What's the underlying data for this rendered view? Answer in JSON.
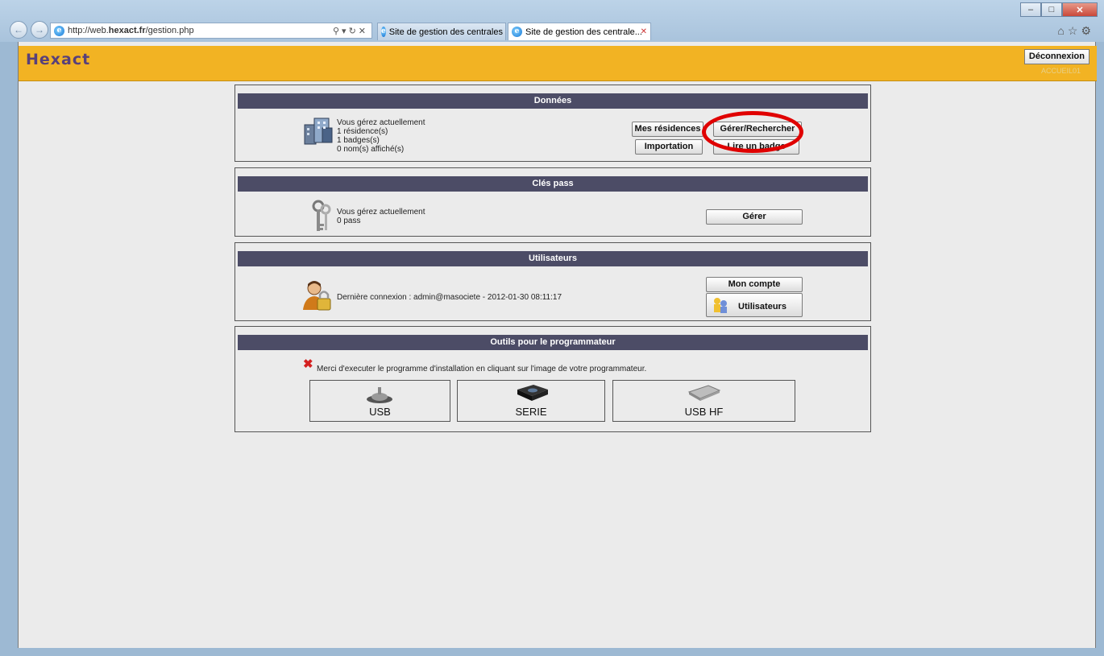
{
  "browser": {
    "url_prefix": "http://web.",
    "url_domain": "hexact.fr",
    "url_path": "/gestion.php",
    "tabs": [
      {
        "label": "Site de gestion des centrales H..."
      },
      {
        "label": "Site de gestion des centrale..."
      }
    ]
  },
  "header": {
    "logo": "Hexact",
    "logout_label": "Déconnexion",
    "user_code": "ACCUEIL01"
  },
  "sections": {
    "donnees": {
      "title": "Données",
      "info": [
        "Vous gérez actuellement",
        "1 résidence(s)",
        "1 badges(s)",
        "0 nom(s) affiché(s)"
      ],
      "buttons": {
        "mes_residences": "Mes résidences",
        "gerer_rechercher": "Gérer/Rechercher",
        "importation": "Importation",
        "lire_badge": "Lire un badge"
      }
    },
    "cles_pass": {
      "title": "Clés pass",
      "info": [
        "Vous gérez actuellement",
        "0 pass"
      ],
      "buttons": {
        "gerer": "Gérer"
      }
    },
    "utilisateurs": {
      "title": "Utilisateurs",
      "info": "Dernière connexion : admin@masociete - 2012-01-30 08:11:17",
      "buttons": {
        "mon_compte": "Mon compte",
        "utilisateurs": "Utilisateurs"
      }
    },
    "outils": {
      "title": "Outils pour le programmateur",
      "message": "Merci d'executer le programme d'installation en cliquant sur l'image de votre programmateur.",
      "programmers": [
        {
          "label": "USB"
        },
        {
          "label": "SERIE"
        },
        {
          "label": "USB HF"
        }
      ]
    }
  },
  "annotation": {
    "color": "#e00000"
  }
}
